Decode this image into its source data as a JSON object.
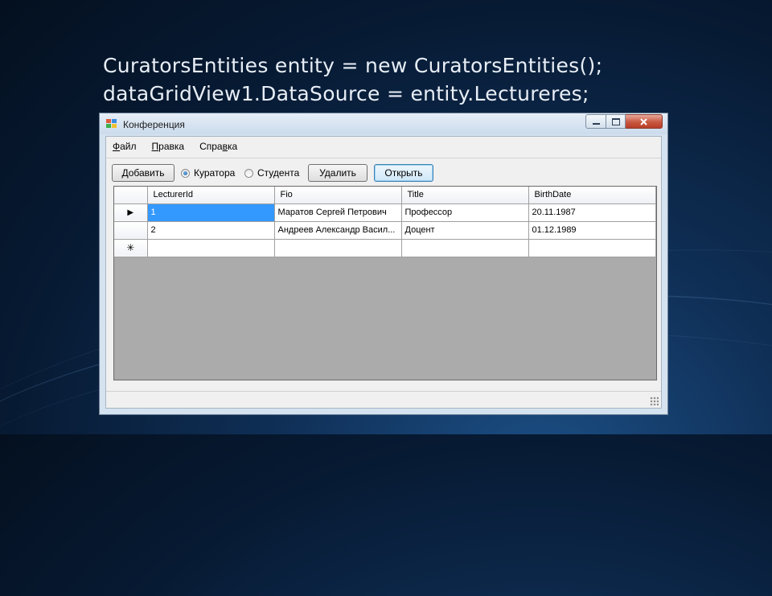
{
  "slide": {
    "code_lines": [
      "CuratorsEntities entity = new CuratorsEntities();",
      "dataGridView1.DataSource = entity.Lectureres;"
    ]
  },
  "window": {
    "title": "Конференция",
    "icon": "form-app-icon",
    "controls": {
      "minimize": "minimize-icon",
      "maximize": "maximize-icon",
      "close": "close-icon"
    }
  },
  "menu": {
    "items": [
      {
        "pre": "",
        "key": "Ф",
        "post": "айл"
      },
      {
        "pre": "",
        "key": "П",
        "post": "равка"
      },
      {
        "pre": "Спра",
        "key": "в",
        "post": "ка"
      }
    ]
  },
  "toolbar": {
    "add_label": "Добавить",
    "radio_curator": "Куратора",
    "radio_student": "Студента",
    "delete_label": "Удалить",
    "open_label": "Открыть",
    "selected_radio": "curator"
  },
  "grid": {
    "columns": [
      "LecturerId",
      "Fio",
      "Title",
      "BirthDate"
    ],
    "rows": [
      [
        "1",
        "Маратов Сергей Петрович",
        "Профессор",
        "20.11.1987"
      ],
      [
        "2",
        "Андреев Александр Васил...",
        "Доцент",
        "01.12.1989"
      ]
    ],
    "current_row_glyph": "▶",
    "new_row_glyph": "✳"
  },
  "colors": {
    "selection": "#3399ff",
    "grid_background": "#ababab",
    "close_button": "#c8573f"
  }
}
